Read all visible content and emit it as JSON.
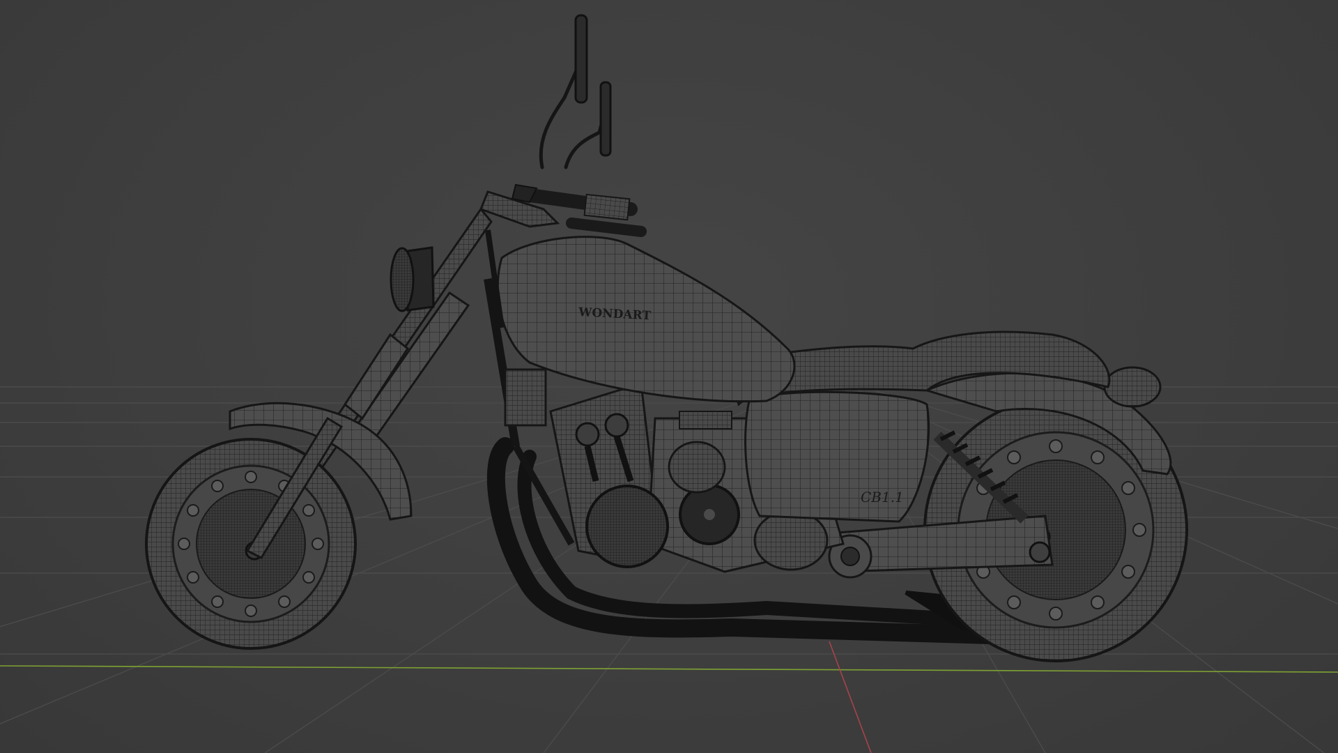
{
  "viewport": {
    "background": "#3d3d3d",
    "grid_color": "#4a4a4a",
    "x_axis_color": "#7ea233",
    "y_axis_color": "#a8434b"
  },
  "model": {
    "type": "motorcycle-wireframe",
    "tank_logo": "WONDART",
    "side_badge": "CB1.1",
    "wire_color": "#1b1b1b",
    "shell_color": "#4c4c4c"
  }
}
